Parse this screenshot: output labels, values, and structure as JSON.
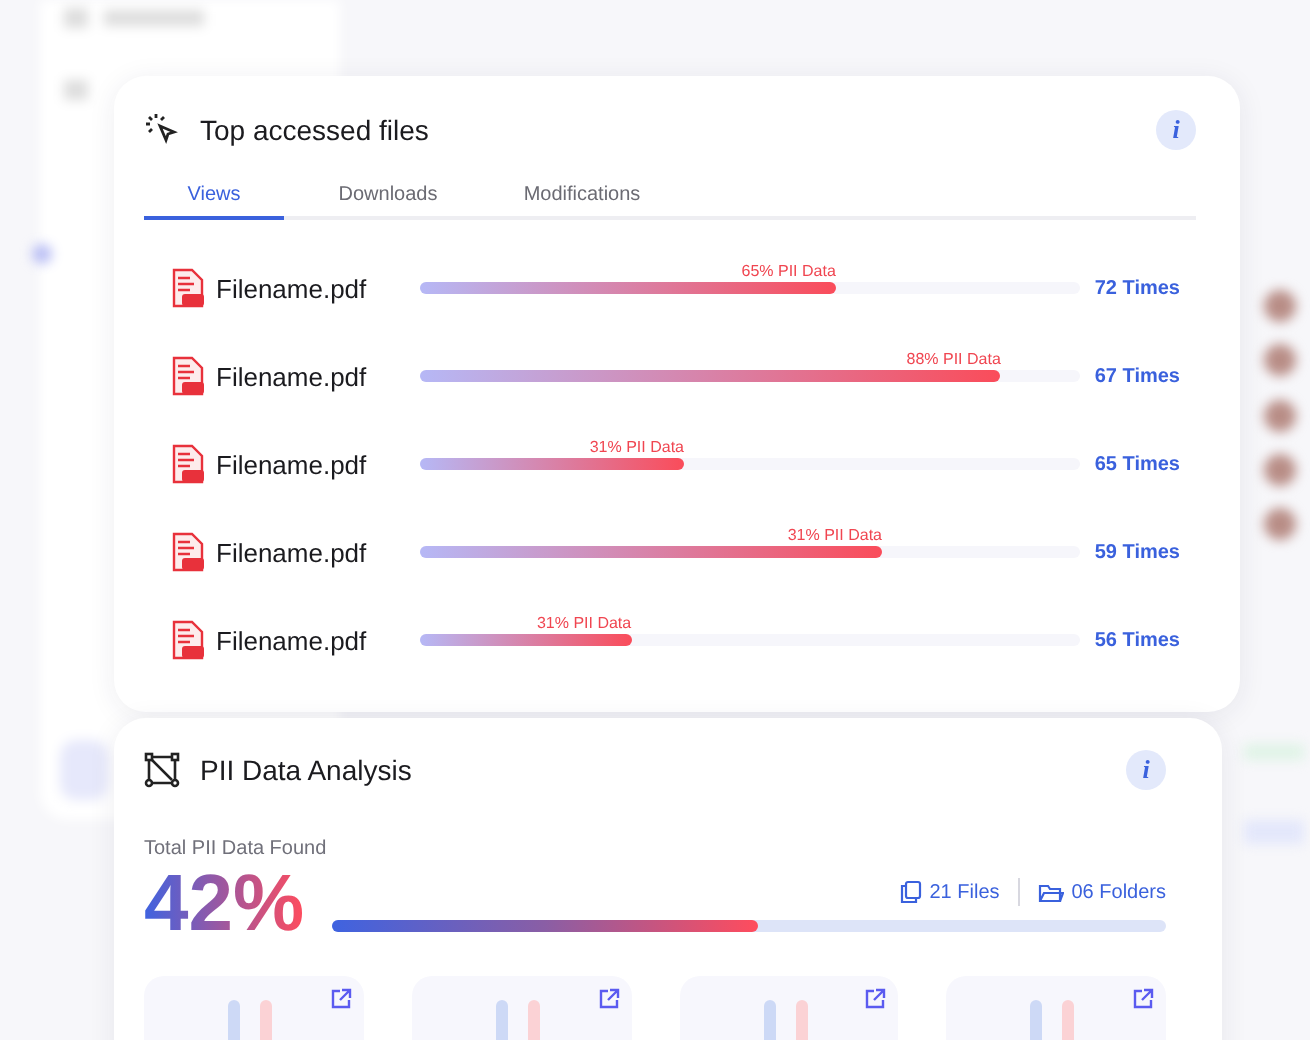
{
  "top_files": {
    "title": "Top accessed files",
    "info": "i",
    "tabs": [
      {
        "label": "Views",
        "selected": true
      },
      {
        "label": "Downloads",
        "selected": false
      },
      {
        "label": "Modifications",
        "selected": false
      }
    ],
    "files": [
      {
        "name": "Filename.pdf",
        "pii": "65% PII Data",
        "level": 0.63,
        "count": "72 Times"
      },
      {
        "name": "Filename.pdf",
        "pii": "88% PII Data",
        "level": 0.88,
        "count": "67 Times"
      },
      {
        "name": "Filename.pdf",
        "pii": "31% PII Data",
        "level": 0.4,
        "count": "65 Times"
      },
      {
        "name": "Filename.pdf",
        "pii": "31% PII Data",
        "level": 0.7,
        "count": "59 Times"
      },
      {
        "name": "Filename.pdf",
        "pii": "31% PII Data",
        "level": 0.32,
        "count": "56 Times"
      }
    ]
  },
  "pii_analysis": {
    "title": "PII Data Analysis",
    "info": "i",
    "total_label": "Total PII Data Found",
    "percent": "42%",
    "level": 0.51,
    "files": "21 Files",
    "folders": "06 Folders",
    "tiles": [
      {
        "kind": "bars"
      },
      {
        "kind": "bars"
      },
      {
        "kind": "bars"
      },
      {
        "kind": "bars"
      }
    ]
  }
}
